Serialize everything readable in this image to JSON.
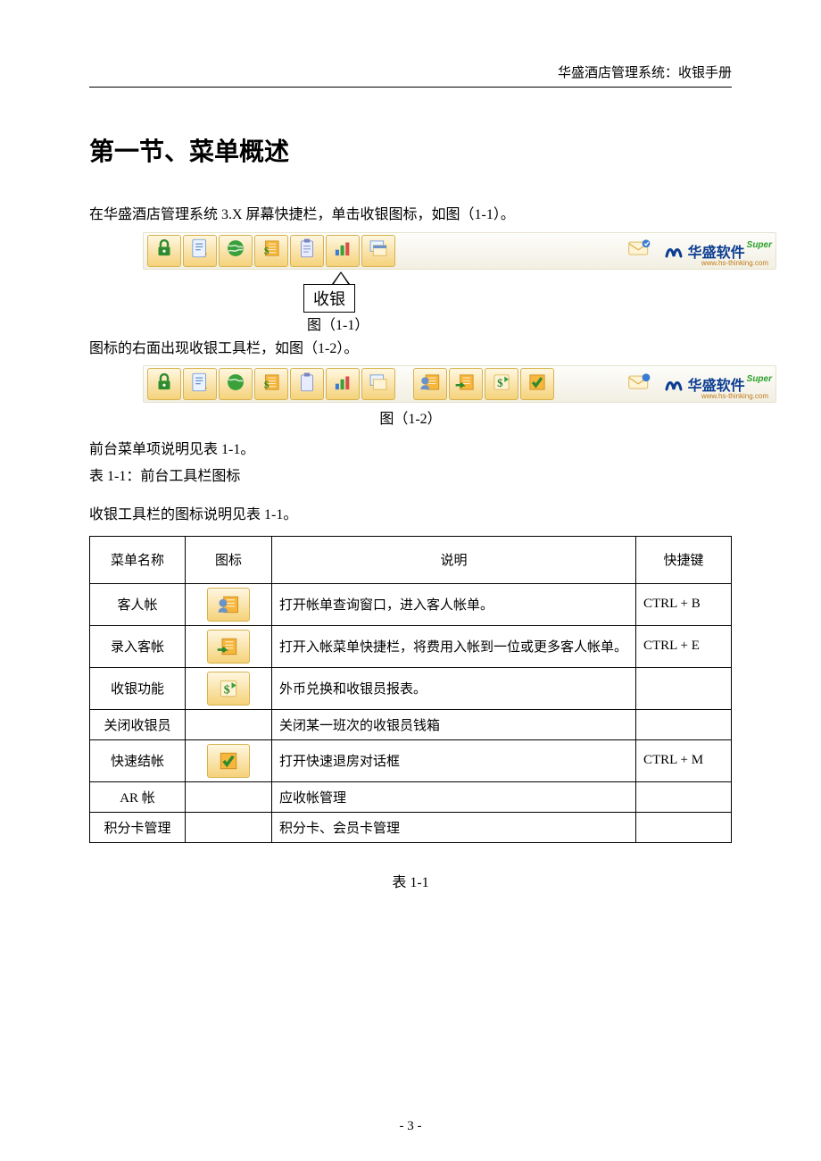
{
  "running_head": "华盛酒店管理系统：收银手册",
  "section_title": "第一节、菜单概述",
  "intro_1": "在华盛酒店管理系统 3.X 屏幕快捷栏，单击收银图标，如图（1-1）。",
  "callout_label": "收银",
  "fig1_label": "图（1-1）",
  "intro_2": "图标的右面出现收银工具栏，如图（1-2）。",
  "fig2_label": "图（1-2）",
  "note1": "前台菜单项说明见表 1-1。",
  "note2": "表 1-1：前台工具栏图标",
  "note3": "收银工具栏的图标说明见表 1-1。",
  "brand_text": "华盛软件",
  "brand_super": "Super",
  "brand_sub": "www.hs-thinking.com",
  "table": {
    "headers": {
      "name": "菜单名称",
      "icon": "图标",
      "desc": "说明",
      "shortcut": "快捷键"
    },
    "rows": [
      {
        "name": "客人帐",
        "desc": "打开帐单查询窗口，进入客人帐单。",
        "shortcut": "CTRL + B"
      },
      {
        "name": "录入客帐",
        "desc": "打开入帐菜单快捷栏，将费用入帐到一位或更多客人帐单。",
        "shortcut": "CTRL + E"
      },
      {
        "name": "收银功能",
        "desc": "外币兑换和收银员报表。",
        "shortcut": ""
      },
      {
        "name": "关闭收银员",
        "desc": "关闭某一班次的收银员钱箱",
        "shortcut": ""
      },
      {
        "name": "快速结帐",
        "desc": "打开快速退房对话框",
        "shortcut": "CTRL + M"
      },
      {
        "name": "AR 帐",
        "desc": "应收帐管理",
        "shortcut": ""
      },
      {
        "name": "积分卡管理",
        "desc": "积分卡、会员卡管理",
        "shortcut": ""
      }
    ],
    "caption": "表 1-1"
  },
  "page_number": "- 3 -"
}
